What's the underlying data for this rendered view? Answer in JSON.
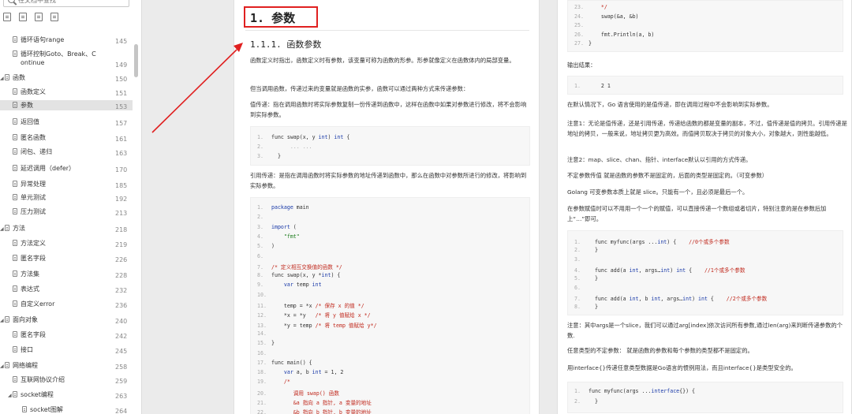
{
  "sidebar": {
    "search_placeholder": "在文档中查找",
    "items": [
      {
        "label": "循环语句range",
        "page": "145",
        "indent": 1
      },
      {
        "label": "循环控制Goto、Break、C\nontinue",
        "page": "149",
        "indent": 1
      },
      {
        "label": "函数",
        "page": "150",
        "indent": 0,
        "expanded": true
      },
      {
        "label": "函数定义",
        "page": "151",
        "indent": 1
      },
      {
        "label": "参数",
        "page": "153",
        "indent": 1,
        "active": true
      },
      {
        "label": "返回值",
        "page": "157",
        "indent": 1
      },
      {
        "label": "匿名函数",
        "page": "161",
        "indent": 1
      },
      {
        "label": "闭包、递归",
        "page": "163",
        "indent": 1
      },
      {
        "label": "延迟调用（defer）",
        "page": "170",
        "indent": 1
      },
      {
        "label": "异常处理",
        "page": "185",
        "indent": 1
      },
      {
        "label": "单元测试",
        "page": "192",
        "indent": 1
      },
      {
        "label": "压力测试",
        "page": "213",
        "indent": 1
      },
      {
        "label": "方法",
        "page": "218",
        "indent": 0,
        "expanded": true
      },
      {
        "label": "方法定义",
        "page": "219",
        "indent": 1
      },
      {
        "label": "匿名字段",
        "page": "226",
        "indent": 1
      },
      {
        "label": "方法集",
        "page": "228",
        "indent": 1
      },
      {
        "label": "表达式",
        "page": "232",
        "indent": 1
      },
      {
        "label": "自定义error",
        "page": "236",
        "indent": 1
      },
      {
        "label": "面向对象",
        "page": "240",
        "indent": 0,
        "expanded": true
      },
      {
        "label": "匿名字段",
        "page": "242",
        "indent": 1
      },
      {
        "label": "接口",
        "page": "245",
        "indent": 1
      },
      {
        "label": "网络编程",
        "page": "258",
        "indent": 0,
        "expanded": true
      },
      {
        "label": "互联网协议介绍",
        "page": "259",
        "indent": 1
      },
      {
        "label": "socket编程",
        "page": "263",
        "indent": 1,
        "expanded": true
      },
      {
        "label": "socket图解",
        "page": "264",
        "indent": 2
      }
    ]
  },
  "left_page": {
    "h1": "1. 参数",
    "h2": "1.1.1. 函数参数",
    "p1": "函数定义时指出，函数定义时有参数，该变量可称为函数的形参。形参就像定义在函数体内的局部变量。",
    "p2": "但当调用函数，传递过来的变量就是函数的实参，函数可以通过两种方式来传递参数：",
    "p3": "值传递：指在调用函数时将实际参数复制一份传递到函数中，这样在函数中如果对参数进行修改，将不会影响到实际参数。",
    "p4": "引用传递：是指在调用函数时将实际参数的地址传递到函数中，那么在函数中对参数所进行的修改，将影响到实际参数。",
    "code1": [
      {
        "n": "1.",
        "html": "func swap(x, y <span class='ty'>int</span>) <span class='ty'>int</span> {"
      },
      {
        "n": "2.",
        "html": "      <span class='lt'>... ...</span>"
      },
      {
        "n": "3.",
        "html": "  }"
      }
    ],
    "code2": [
      {
        "n": "1.",
        "html": "<span class='kw'>package</span> main"
      },
      {
        "n": "2.",
        "html": ""
      },
      {
        "n": "3.",
        "html": "<span class='kw'>import</span> ("
      },
      {
        "n": "4.",
        "html": "    <span class='st'>\"fmt\"</span>"
      },
      {
        "n": "5.",
        "html": ")"
      },
      {
        "n": "6.",
        "html": ""
      },
      {
        "n": "7.",
        "html": "<span class='cm'>/* 定义相互交换值的函数 */</span>"
      },
      {
        "n": "8.",
        "html": "func swap(x, y *<span class='ty'>int</span>) {"
      },
      {
        "n": "9.",
        "html": "    <span class='kw'>var</span> temp <span class='ty'>int</span>"
      },
      {
        "n": "10.",
        "html": ""
      },
      {
        "n": "11.",
        "html": "    temp = *x <span class='cm'>/* 保存 x 的值 */</span>"
      },
      {
        "n": "12.",
        "html": "    *x = *y   <span class='cm'>/* 将 y 值赋给 x */</span>"
      },
      {
        "n": "13.",
        "html": "    *y = temp <span class='cm'>/* 将 temp 值赋给 y*/</span>"
      },
      {
        "n": "14.",
        "html": ""
      },
      {
        "n": "15.",
        "html": "}"
      },
      {
        "n": "16.",
        "html": ""
      },
      {
        "n": "17.",
        "html": "func main() {"
      },
      {
        "n": "18.",
        "html": "    <span class='kw'>var</span> a, b <span class='ty'>int</span> = 1, 2"
      },
      {
        "n": "19.",
        "html": "    <span class='cm'>/*</span>"
      },
      {
        "n": "20.",
        "html": "       <span class='cm'>调用 swap() 函数</span>"
      },
      {
        "n": "21.",
        "html": "       <span class='cm'>&a 指向 a 指针, a 变量的地址</span>"
      },
      {
        "n": "22.",
        "html": "       <span class='cm'>&b 指向 b 指针, b 变量的地址</span>"
      }
    ]
  },
  "right_page": {
    "code_top": [
      {
        "n": "23.",
        "html": "    <span class='cm'>*/</span>"
      },
      {
        "n": "24.",
        "html": "    swap(&a, &b)"
      },
      {
        "n": "25.",
        "html": ""
      },
      {
        "n": "26.",
        "html": "    fmt.Println(a, b)"
      },
      {
        "n": "27.",
        "html": "}"
      }
    ],
    "output_label": "输出结果：",
    "output_code": [
      {
        "n": "1.",
        "html": "    2 1"
      }
    ],
    "p1": "在默认情况下，Go 语言使用的是值传递，即在调用过程中不会影响到实际参数。",
    "p2": "注意1：无论是值传递，还是引用传递，传递给函数的都是变量的副本，不过，值传递是值的拷贝。引用传递是地址的拷贝，一般来说，地址拷贝更为高效。而值拷贝取决于拷贝的对象大小，对象越大，则性能越低。",
    "p3": "注意2：map、slice、chan、指针、interface默认以引用的方式传递。",
    "p4": "不定参数传值 就是函数的参数不是固定的，后面的类型是固定的。（可变参数）",
    "p5": "Golang 可变参数本质上就是 slice。只能有一个，且必须是最后一个。",
    "p6": "在参数赋值时可以不用用一个一个的赋值，可以直接传递一个数组或者切片，特别注意的是在参数后加上“…”即可。",
    "code_mid": [
      {
        "n": "1.",
        "html": "  func myfunc(args ...<span class='ty'>int</span>) {    <span class='cm'>//0个或多个参数</span>"
      },
      {
        "n": "2.",
        "html": "  }"
      },
      {
        "n": "3.",
        "html": ""
      },
      {
        "n": "4.",
        "html": "  func add(a <span class='ty'>int</span>, args…<span class='ty'>int</span>) <span class='ty'>int</span> {    <span class='cm'>//1个或多个参数</span>"
      },
      {
        "n": "5.",
        "html": "  }"
      },
      {
        "n": "6.",
        "html": ""
      },
      {
        "n": "7.",
        "html": "  func add(a <span class='ty'>int</span>, b <span class='ty'>int</span>, args…<span class='ty'>int</span>) <span class='ty'>int</span> {    <span class='cm'>//2个或多个参数</span>"
      },
      {
        "n": "8.",
        "html": "  }"
      }
    ],
    "p7": "注意：其中args是一个slice，我们可以通过arg[index]依次访问所有参数,通过len(arg)来判断传递参数的个数.",
    "p8": "任意类型的不定参数： 就是函数的参数和每个参数的类型都不是固定的。",
    "p9": "用interface{}传递任意类型数据是Go语言的惯例用法，而且interface{}是类型安全的。",
    "code_bot": [
      {
        "n": "1.",
        "html": "func myfunc(args ...<span class='kw'>interface</span>{}) {"
      },
      {
        "n": "2.",
        "html": "  }"
      }
    ]
  },
  "colors": {
    "highlight_box": "#e02020",
    "arrow": "#e02020"
  }
}
